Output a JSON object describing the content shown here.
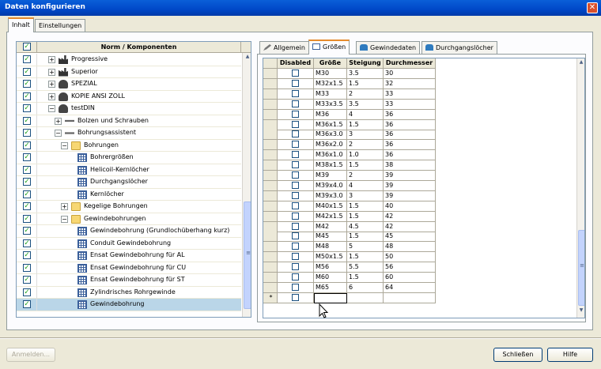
{
  "window": {
    "title": "Daten konfigurieren",
    "close": "✕"
  },
  "outer_tabs": [
    {
      "label": "Inhalt",
      "active": true
    },
    {
      "label": "Einstellungen",
      "active": false
    }
  ],
  "tree": {
    "header_label": "Norm / Komponenten",
    "check_mark": "✓",
    "expand_plus": "+",
    "expand_minus": "−",
    "rows": [
      {
        "label": "Progressive",
        "indent": 0,
        "expander": "+",
        "icon": "factory-icon",
        "checked": true
      },
      {
        "label": "Superior",
        "indent": 0,
        "expander": "+",
        "icon": "factory-icon",
        "checked": true
      },
      {
        "label": "SPEZIAL",
        "indent": 0,
        "expander": "+",
        "icon": "person-icon",
        "checked": true
      },
      {
        "label": "KOPIE ANSI ZOLL",
        "indent": 0,
        "expander": "+",
        "icon": "person-icon",
        "checked": true
      },
      {
        "label": "testDIN",
        "indent": 0,
        "expander": "−",
        "icon": "person-icon",
        "checked": true
      },
      {
        "label": "Bolzen und Schrauben",
        "indent": 1,
        "expander": "+",
        "icon": "tool-icon",
        "checked": true
      },
      {
        "label": "Bohrungsassistent",
        "indent": 1,
        "expander": "−",
        "icon": "tool-icon",
        "checked": true
      },
      {
        "label": "Bohrungen",
        "indent": 2,
        "expander": "−",
        "icon": "folder-icon",
        "checked": true
      },
      {
        "label": "Bohrergrößen",
        "indent": 3,
        "expander": "",
        "icon": "grid-icon",
        "checked": true
      },
      {
        "label": "Helicoil-Kernlöcher",
        "indent": 3,
        "expander": "",
        "icon": "grid-icon",
        "checked": true
      },
      {
        "label": "Durchgangslöcher",
        "indent": 3,
        "expander": "",
        "icon": "grid-icon",
        "checked": true
      },
      {
        "label": "Kernlöcher",
        "indent": 3,
        "expander": "",
        "icon": "grid-icon",
        "checked": true
      },
      {
        "label": "Kegelige Bohrungen",
        "indent": 2,
        "expander": "+",
        "icon": "folder-icon",
        "checked": true
      },
      {
        "label": "Gewindebohrungen",
        "indent": 2,
        "expander": "−",
        "icon": "folder-icon",
        "checked": true
      },
      {
        "label": "Gewindebohrung (Grundlochüberhang kurz)",
        "indent": 3,
        "expander": "",
        "icon": "grid-icon",
        "checked": true
      },
      {
        "label": "Conduit Gewindebohrung",
        "indent": 3,
        "expander": "",
        "icon": "grid-icon",
        "checked": true
      },
      {
        "label": "Ensat Gewindebohrung für AL",
        "indent": 3,
        "expander": "",
        "icon": "grid-icon",
        "checked": true
      },
      {
        "label": "Ensat Gewindebohrung für CU",
        "indent": 3,
        "expander": "",
        "icon": "grid-icon",
        "checked": true
      },
      {
        "label": "Ensat Gewindebohrung für ST",
        "indent": 3,
        "expander": "",
        "icon": "grid-icon",
        "checked": true
      },
      {
        "label": "Zylindrisches Rohrgewinde",
        "indent": 3,
        "expander": "",
        "icon": "grid-icon",
        "checked": true
      },
      {
        "label": "Gewindebohrung",
        "indent": 3,
        "expander": "",
        "icon": "grid-icon",
        "checked": true,
        "selected": true
      }
    ]
  },
  "inner_tabs": [
    {
      "label": "Allgemein",
      "active": false,
      "icon": "pencil-icon"
    },
    {
      "label": "Größen",
      "active": true,
      "icon": "table-icon"
    },
    {
      "label": "Gewindedaten",
      "active": false,
      "icon": "dataset-icon"
    },
    {
      "label": "Durchgangslöcher",
      "active": false,
      "icon": "dataset-icon"
    }
  ],
  "grid": {
    "columns": [
      "Disabled",
      "Größe",
      "Steigung",
      "Durchmesser"
    ],
    "new_row_marker": "*",
    "rows": [
      [
        "M30",
        "3.5",
        "30"
      ],
      [
        "M32x1.5",
        "1.5",
        "32"
      ],
      [
        "M33",
        "2",
        "33"
      ],
      [
        "M33x3.5",
        "3.5",
        "33"
      ],
      [
        "M36",
        "4",
        "36"
      ],
      [
        "M36x1.5",
        "1.5",
        "36"
      ],
      [
        "M36x3.0",
        "3",
        "36"
      ],
      [
        "M36x2.0",
        "2",
        "36"
      ],
      [
        "M36x1.0",
        "1.0",
        "36"
      ],
      [
        "M38x1.5",
        "1.5",
        "38"
      ],
      [
        "M39",
        "2",
        "39"
      ],
      [
        "M39x4.0",
        "4",
        "39"
      ],
      [
        "M39x3.0",
        "3",
        "39"
      ],
      [
        "M40x1.5",
        "1.5",
        "40"
      ],
      [
        "M42x1.5",
        "1.5",
        "42"
      ],
      [
        "M42",
        "4.5",
        "42"
      ],
      [
        "M45",
        "1.5",
        "45"
      ],
      [
        "M48",
        "5",
        "48"
      ],
      [
        "M50x1.5",
        "1.5",
        "50"
      ],
      [
        "M56",
        "5.5",
        "56"
      ],
      [
        "M60",
        "1.5",
        "60"
      ],
      [
        "M65",
        "6",
        "64"
      ]
    ]
  },
  "buttons": {
    "apply": "Anmelden...",
    "close": "Schließen",
    "help": "Hilfe"
  },
  "scrollbar": {
    "up": "▲",
    "down": "▼",
    "grip": "≡"
  }
}
